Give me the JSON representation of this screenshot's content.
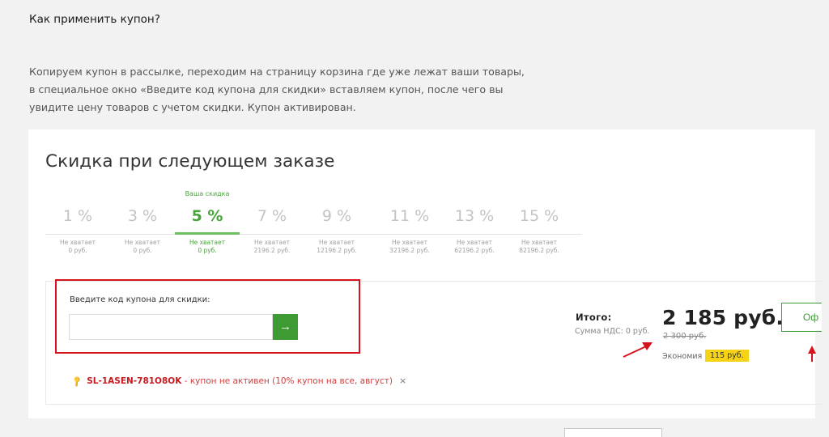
{
  "faq": {
    "title": "Как применить купон?",
    "text": "Копируем купон в рассылке, переходим на страницу корзина где уже лежат ваши товары, в специальное окно «Введите код купона для скидки» вставляем купон, после чего вы увидите цену товаров с учетом скидки. Купон активирован."
  },
  "discount": {
    "title": "Скидка при следующем заказе",
    "current_badge": "Ваша скидка",
    "tiers": [
      {
        "pct": "1 %",
        "note1": "Не хватает",
        "note2": "0 руб."
      },
      {
        "pct": "3 %",
        "note1": "Не хватает",
        "note2": "0 руб."
      },
      {
        "pct": "5 %",
        "note1": "Не хватает",
        "note2": "0 руб."
      },
      {
        "pct": "7 %",
        "note1": "Не хватает",
        "note2": "2196.2 руб."
      },
      {
        "pct": "9 %",
        "note1": "Не хватает",
        "note2": "12196.2 руб."
      },
      {
        "pct": "11 %",
        "note1": "Не хватает",
        "note2": "32196.2 руб."
      },
      {
        "pct": "13 %",
        "note1": "Не хватает",
        "note2": "62196.2 руб."
      },
      {
        "pct": "15 %",
        "note1": "Не хватает",
        "note2": "82196.2 руб."
      }
    ],
    "active_index": 2
  },
  "coupon": {
    "label": "Введите код купона для скидки:",
    "input_value": "",
    "submit_icon": "→",
    "applied_code": "SL-1ASEN-781O8OK",
    "applied_message": " - купон не активен (10% купон на все, август)",
    "remove_icon": "×"
  },
  "summary": {
    "total_label": "Итого:",
    "vat_label": "Сумма НДС: 0 руб.",
    "price": "2 185 руб.",
    "old_price": "2 300 руб.",
    "savings_label": "Экономия",
    "savings_value": "115 руб.",
    "checkout_label": "Оф"
  },
  "colors": {
    "accent_green": "#3e9a33",
    "highlight_red": "#d6131c",
    "savings_yellow": "#f7d317"
  },
  "icons": {
    "coupon_key": "key-icon",
    "submit": "arrow-right-icon",
    "remove": "close-icon"
  }
}
